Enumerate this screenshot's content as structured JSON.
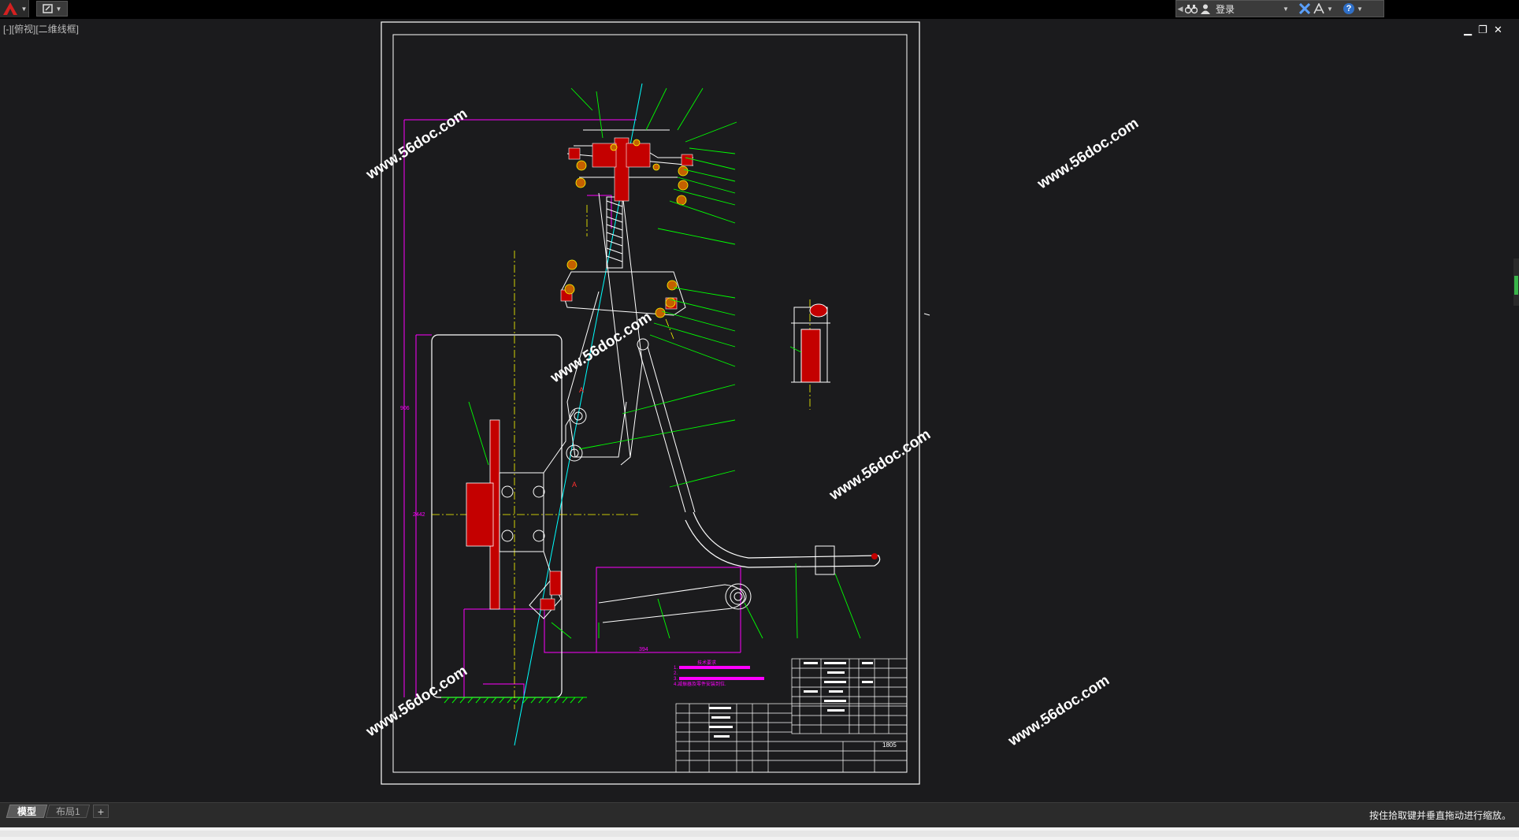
{
  "topbar": {
    "app_menu_icon": "autocad-a-logo-icon",
    "quick_access_icon": "workspace-icon",
    "infocenter": {
      "login_label": "登录",
      "icons": [
        "search-binoculars-icon",
        "user-icon",
        "exchange-x-icon",
        "autodesk-a360-icon",
        "help-icon"
      ]
    }
  },
  "viewport": {
    "label": "[-][俯视][二维线框]",
    "controls": [
      "minimize-icon",
      "restore-icon",
      "close-icon"
    ]
  },
  "drawing": {
    "watermark": "www.56doc.com",
    "tech_requirements_title": "技术要求",
    "tech_items": [
      "1.",
      "2.",
      "3.",
      "4.减振器及零件安装到位."
    ],
    "title_block_code": "1805",
    "colors": {
      "frame": "#ffffff",
      "dimension": "#ff00ff",
      "leader": "#00ff00",
      "section": "#c40000",
      "center": "#ffff00",
      "axis": "#00ffff",
      "watermark": "#ffffff"
    }
  },
  "layout_tabs": {
    "model": "模型",
    "layout1": "布局1",
    "add": "+"
  },
  "status": {
    "message": "按住拾取键并垂直拖动进行缩放。"
  }
}
